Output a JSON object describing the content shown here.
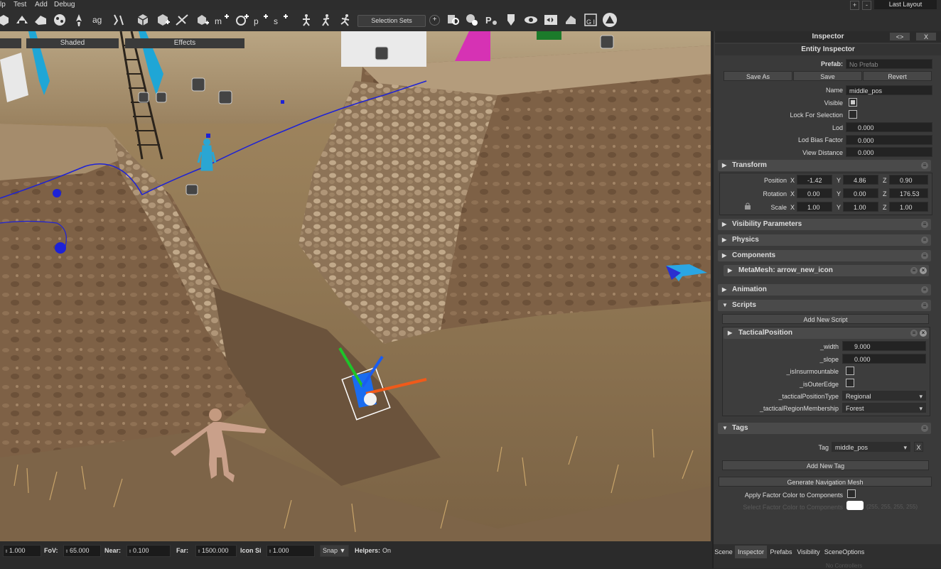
{
  "menu": {
    "items": [
      "lp",
      "Test",
      "Add",
      "Debug"
    ],
    "layout": "Last Layout",
    "plus": "+",
    "minus": "-"
  },
  "toolbar": {
    "selection_sets": "Selection Sets",
    "plus": "+",
    "icons": [
      "select-object-icon",
      "move-tool-icon",
      "rotate-tool-icon",
      "scale-tool-icon",
      "paint-tool-icon",
      "text-ag-icon",
      "snap-icon",
      "cube-icon",
      "cube-add-icon",
      "terrain-line-icon",
      "entity-add-icon",
      "mesh-add-icon",
      "particle-add-icon",
      "point-add-icon",
      "script-add-icon",
      "character-icon",
      "walk-icon",
      "run-icon",
      "search-entity-icon",
      "settings-entity-icon",
      "physics-icon",
      "shield-icon",
      "eye-icon",
      "volume-icon",
      "light-icon",
      "gi-icon",
      "warning-icon"
    ]
  },
  "viewport": {
    "tabs": [
      "",
      "Shaded",
      "Effects"
    ]
  },
  "bottom": {
    "val1": "1.000",
    "fov_label": "FoV:",
    "fov_value": "65.000",
    "near_label": "Near:",
    "near_value": "0.100",
    "far_label": "Far:",
    "far_value": "1500.000",
    "icon_size_label": "Icon Si",
    "icon_size_value": "1.000",
    "snap_label": "Snap",
    "helpers_label": "Helpers:",
    "helpers_value": "On"
  },
  "inspector": {
    "title": "Inspector",
    "btn_swap": "<>",
    "btn_close": "X",
    "entity_title": "Entity Inspector",
    "prefab_label": "Prefab:",
    "prefab_value": "No Prefab",
    "save_as": "Save As",
    "save": "Save",
    "revert": "Revert",
    "name_label": "Name",
    "name_value": "middle_pos",
    "visible_label": "Visible",
    "visible_checked": true,
    "lock_label": "Lock For Selection",
    "lock_checked": false,
    "lod_label": "Lod",
    "lod_value": "0.000",
    "lod_bias_label": "Lod Bias Factor",
    "lod_bias_value": "0.000",
    "view_distance_label": "View Distance",
    "view_distance_value": "0.000",
    "transform": {
      "title": "Transform",
      "position_label": "Position",
      "rotation_label": "Rotation",
      "scale_label": "Scale",
      "x": "X",
      "y": "Y",
      "z": "Z",
      "position": [
        "-1.42",
        "4.86",
        "0.90"
      ],
      "rotation": [
        "0.00",
        "0.00",
        "176.53"
      ],
      "scale": [
        "1.00",
        "1.00",
        "1.00"
      ]
    },
    "sections": {
      "visibility": "Visibility Parameters",
      "physics": "Physics",
      "components": "Components",
      "metamesh": "MetaMesh: arrow_new_icon",
      "animation": "Animation",
      "scripts": "Scripts",
      "tags": "Tags"
    },
    "add_new_script": "Add New Script",
    "tactical": {
      "title": "TacticalPosition",
      "width_label": "_width",
      "width_value": "9.000",
      "slope_label": "_slope",
      "slope_value": "0.000",
      "insurmountable_label": "_isInsurmountable",
      "outer_edge_label": "_isOuterEdge",
      "type_label": "_tacticalPositionType",
      "type_value": "Regional",
      "region_label": "_tacticalRegionMembership",
      "region_value": "Forest"
    },
    "tag_label": "Tag",
    "tag_value": "middle_pos",
    "tag_remove": "X",
    "add_new_tag": "Add New Tag",
    "generate_navmesh": "Generate Navigation Mesh",
    "apply_factor_label": "Apply Factor Color to Components",
    "select_factor_label": "Select Factor Color to Components",
    "factor_color_value": "(255, 255, 255, 255)",
    "factor_color": "#ffffff",
    "bottom_tabs": [
      "Scene",
      "Inspector",
      "Prefabs",
      "Visibility",
      "SceneOptions"
    ],
    "active_tab": "Inspector",
    "footer_hint": "No Controllers"
  }
}
